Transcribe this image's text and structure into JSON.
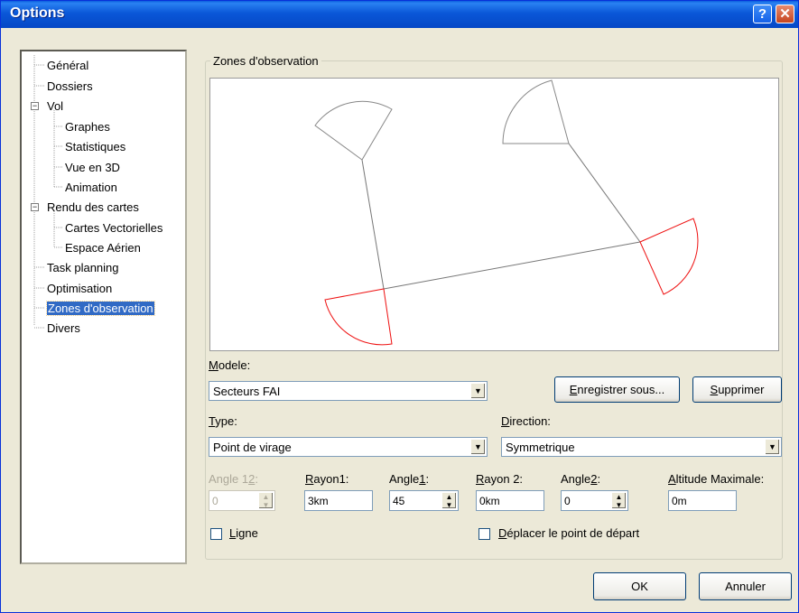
{
  "window": {
    "title": "Options",
    "help_glyph": "?",
    "close_glyph": "✕"
  },
  "tree": {
    "items": [
      {
        "label": "Général"
      },
      {
        "label": "Dossiers"
      },
      {
        "label": "Vol"
      },
      {
        "label": "Graphes"
      },
      {
        "label": "Statistiques"
      },
      {
        "label": "Vue en 3D"
      },
      {
        "label": "Animation"
      },
      {
        "label": "Rendu des cartes"
      },
      {
        "label": "Cartes Vectorielles"
      },
      {
        "label": "Espace Aérien"
      },
      {
        "label": "Task planning"
      },
      {
        "label": "Optimisation"
      },
      {
        "label": "Zones d'observation"
      },
      {
        "label": "Divers"
      }
    ],
    "selected": "Zones d'observation",
    "expander_glyph": "−"
  },
  "panel": {
    "group_title": "Zones d'observation",
    "modele": {
      "label_u": "M",
      "label_rest": "odele:",
      "value": "Secteurs FAI"
    },
    "save_as": {
      "u": "E",
      "rest": "nregistrer sous..."
    },
    "delete": {
      "u": "S",
      "rest": "upprimer"
    },
    "type": {
      "label_u": "T",
      "label_rest": "ype:",
      "value": "Point de virage"
    },
    "direction": {
      "label_u": "D",
      "label_rest": "irection:",
      "value": "Symmetrique"
    },
    "angle12": {
      "label_pre": "Angle 1",
      "label_u": "2",
      "label_post": ":",
      "value": "0"
    },
    "rayon1": {
      "label_u": "R",
      "label_rest": "ayon1:",
      "value": "3km"
    },
    "angle1": {
      "label_pre": "Angle",
      "label_u": "1",
      "label_post": ":",
      "value": "45"
    },
    "rayon2": {
      "label_u": "R",
      "label_rest": "ayon 2:",
      "value": "0km"
    },
    "angle2": {
      "label_pre": "Angle",
      "label_u": "2",
      "label_post": ":",
      "value": "0"
    },
    "altitude": {
      "label_u": "A",
      "label_rest": "ltitude Maximale:",
      "value": "0m"
    },
    "ligne": {
      "label_u": "L",
      "label_rest": "igne",
      "checked": false
    },
    "deplacer": {
      "label_u": "D",
      "label_rest": "éplacer le point de départ",
      "checked": false
    },
    "arrow_glyph": "▼",
    "spin_up": "▲",
    "spin_down": "▼"
  },
  "footer": {
    "ok": "OK",
    "cancel": "Annuler"
  },
  "colors": {
    "sector_gray": "#888888",
    "sector_red": "#ee1111",
    "task_line": "#777777"
  }
}
